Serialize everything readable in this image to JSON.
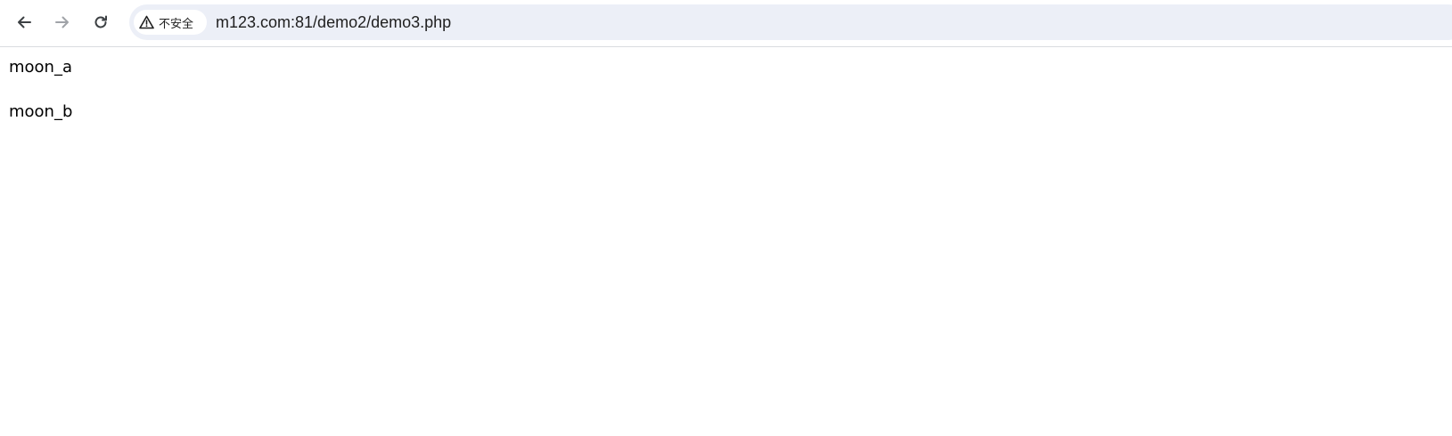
{
  "browser": {
    "nav": {
      "back_icon": "arrow-left-icon",
      "forward_icon": "arrow-right-icon",
      "reload_icon": "reload-icon"
    },
    "omnibox": {
      "security_icon": "warning-triangle-icon",
      "security_label": "不安全",
      "url": "m123.com:81/demo2/demo3.php"
    },
    "colors": {
      "omnibox_bg": "#eceff7",
      "icon_active": "#3c4043",
      "icon_disabled": "#a0a3a8"
    }
  },
  "page": {
    "lines": [
      "moon_a",
      "moon_b"
    ]
  }
}
